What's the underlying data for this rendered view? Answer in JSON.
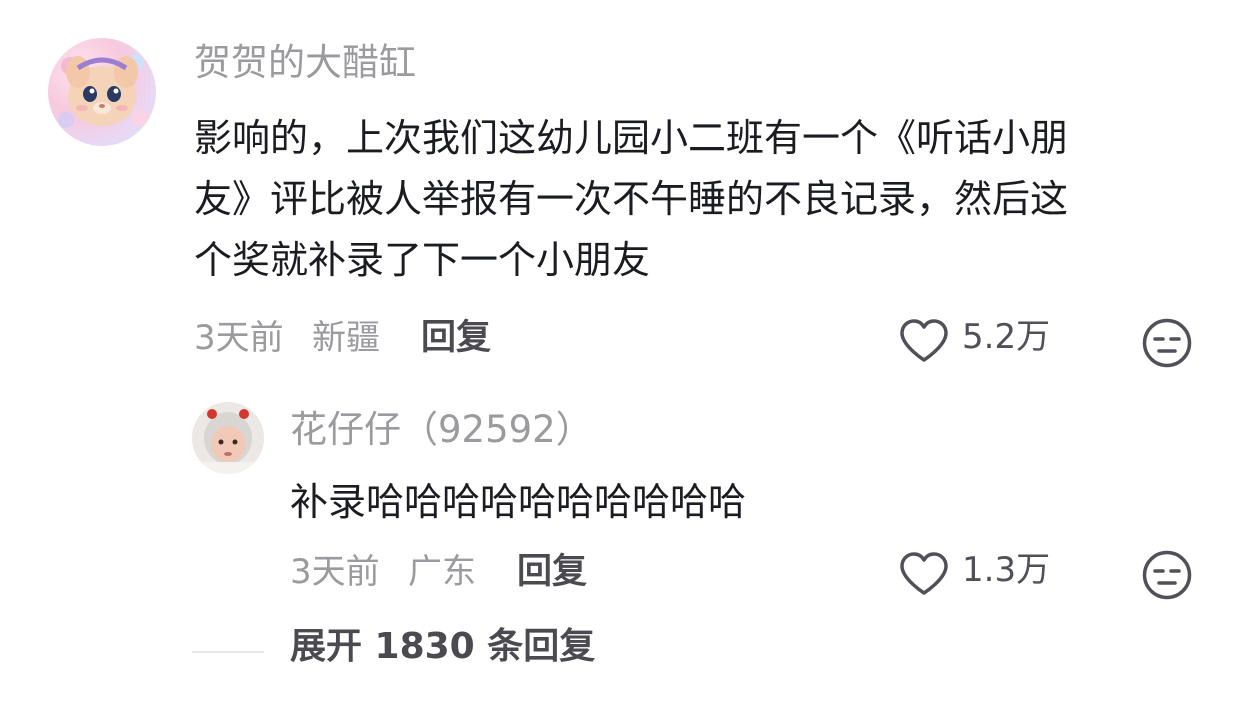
{
  "comment": {
    "username": "贺贺的大醋缸",
    "text_lines": [
      "影响的，上次我们这幼儿园小二班有一个《听话小朋",
      "友》评比被人举报有一次不午睡的不良记录，然后这",
      "个奖就补录了下一个小朋友"
    ],
    "time": "3天前",
    "location": "新疆",
    "reply_label": "回复",
    "likes": "5.2万",
    "like_icon": "heart-outline-icon",
    "dislike_icon": "expressionless-face-icon"
  },
  "reply": {
    "username": "花仔仔（92592）",
    "text": "补录哈哈哈哈哈哈哈哈哈哈",
    "time": "3天前",
    "location": "广东",
    "reply_label": "回复",
    "likes": "1.3万",
    "like_icon": "heart-outline-icon",
    "dislike_icon": "expressionless-face-icon"
  },
  "expand_replies": "展开 1830 条回复",
  "colors": {
    "text_primary": "#1b1c22",
    "text_secondary": "#9a9a9f",
    "icon_gray": "#505058"
  }
}
